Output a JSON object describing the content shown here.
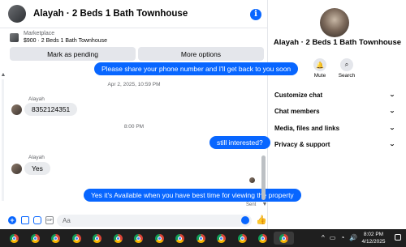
{
  "header": {
    "title": "Alayah · 2 Beds 1 Bath Townhouse",
    "info_icon": "info-icon",
    "info_glyph": "i"
  },
  "listing": {
    "source": "Marketplace",
    "price_title": "$900 · 2 Beds 1 Bath Townhouse"
  },
  "actions": {
    "mark_pending": "Mark as pending",
    "more_options": "More options"
  },
  "messages": [
    {
      "type": "outgoing",
      "text": "Please share your phone number and I'll get back to you soon"
    },
    {
      "type": "timestamp",
      "text": "Apr 2, 2025, 10:59 PM"
    },
    {
      "type": "sender",
      "text": "Alayah"
    },
    {
      "type": "incoming",
      "text": "8352124351"
    },
    {
      "type": "timestamp",
      "text": "8:00 PM"
    },
    {
      "type": "outgoing",
      "text": "still interested?"
    },
    {
      "type": "sender",
      "text": "Alayah"
    },
    {
      "type": "incoming",
      "text": "Yes"
    },
    {
      "type": "outgoing",
      "text": "Yes it's Available when you have best time for viewing the property"
    }
  ],
  "sent_status": "Sent",
  "composer": {
    "placeholder": "Aa",
    "plus_glyph": "+",
    "gif_glyph": "GIF",
    "like_glyph": "👍"
  },
  "details": {
    "name": "Alayah · 2 Beds 1 Bath Townhouse",
    "actions": [
      {
        "label": "Mute",
        "icon": "bell-icon",
        "glyph": "🔔"
      },
      {
        "label": "Search",
        "icon": "search-icon",
        "glyph": "⌕"
      }
    ],
    "sections": [
      {
        "label": "Customize chat"
      },
      {
        "label": "Chat members"
      },
      {
        "label": "Media, files and links"
      },
      {
        "label": "Privacy & support"
      }
    ],
    "chevron": "⌄"
  },
  "taskbar": {
    "time": "8:02 PM",
    "date": "4/12/2025",
    "tray_glyphs": [
      "^",
      "▭",
      "◔",
      "🔊"
    ],
    "apps_count": 14
  },
  "scroll_glyphs": {
    "up": "▲",
    "down": "▼"
  },
  "colors": {
    "accent": "#0866ff",
    "bubble_in": "#e9ebee",
    "taskbar": "#1f1f1f"
  }
}
